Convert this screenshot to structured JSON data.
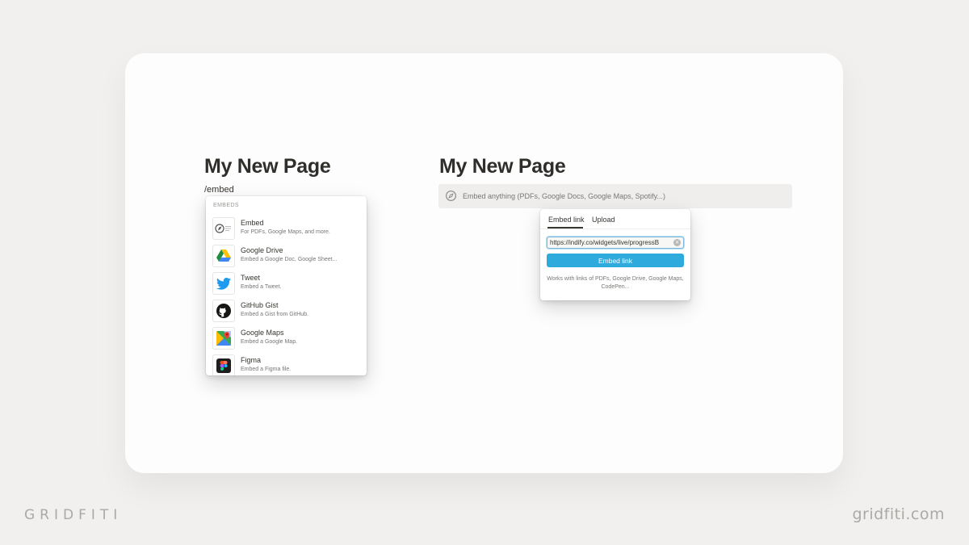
{
  "left": {
    "title": "My New Page",
    "command": "/embed",
    "menu": {
      "header": "EMBEDS",
      "items": [
        {
          "title": "Embed",
          "desc": "For PDFs, Google Maps, and more.",
          "icon": "embed-icon"
        },
        {
          "title": "Google Drive",
          "desc": "Embed a Google Doc, Google Sheet...",
          "icon": "google-drive-icon"
        },
        {
          "title": "Tweet",
          "desc": "Embed a Tweet.",
          "icon": "twitter-icon"
        },
        {
          "title": "GitHub Gist",
          "desc": "Embed a Gist from GitHub.",
          "icon": "github-icon"
        },
        {
          "title": "Google Maps",
          "desc": "Embed a Google Map.",
          "icon": "google-maps-icon"
        },
        {
          "title": "Figma",
          "desc": "Embed a Figma file.",
          "icon": "figma-icon"
        }
      ]
    }
  },
  "right": {
    "title": "My New Page",
    "embed_block": {
      "text": "Embed anything (PDFs, Google Docs, Google Maps, Spotify...)",
      "icon": "compass-icon"
    },
    "popup": {
      "tabs": [
        {
          "label": "Embed link",
          "active": true
        },
        {
          "label": "Upload",
          "active": false
        }
      ],
      "url_value": "https://indify.co/widgets/live/progressB",
      "button_label": "Embed link",
      "help_text": "Works with links of PDFs, Google Drive, Google Maps, CodePen..."
    }
  },
  "brand": {
    "left": "GRIDFITI",
    "right": "gridfiti.com"
  },
  "colors": {
    "accent": "#2eaadc",
    "background": "#f1f0ef",
    "card": "#fdfdfd",
    "twitter": "#1d9bf0"
  }
}
